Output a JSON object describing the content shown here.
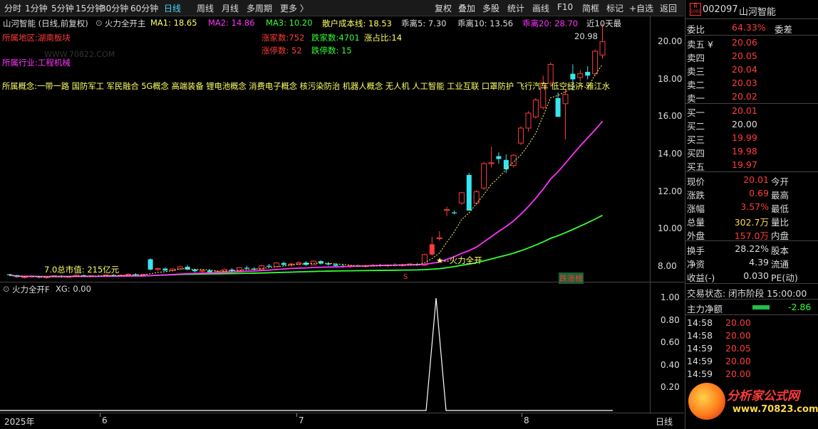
{
  "toolbar": {
    "items": [
      "分时",
      "1分钟",
      "5分钟",
      "15分钟",
      "30分钟",
      "60分钟",
      "日线",
      "周线",
      "月线",
      "多周期",
      "更多 〉"
    ],
    "right_items": [
      "复权",
      "叠加",
      "多股",
      "统计",
      "画线",
      "F10",
      "简框",
      "标记",
      "+自选",
      "返回"
    ]
  },
  "main_info": {
    "stock_title": "山河智能 (日线,前复权)",
    "indicator_name": "火力全开主",
    "ma1": "MA1: 18.65",
    "ma2": "MA2: 14.86",
    "ma3": "MA3: 10.20",
    "retail_cost": "散户成本线: 18.53",
    "dev5": "乖离5: 7.30",
    "dev10": "乖离10: 13.56",
    "dev20": "乖离20: 28.70",
    "recent10": "近10天最",
    "up_count": "涨家数:752",
    "down_count": "跌家数:4701",
    "up_ratio": "涨占比:14",
    "limit_up": "涨停数: 52",
    "limit_down": "跌停数: 15",
    "region": "所属地区:湖南板块",
    "industry": "所属行业:工程机械",
    "concepts": "所属概念:一带一路 国防军工 军民融合 5G概念 高端装备 锂电池概念 消费电子概念 核污染防治 机器人概念 无人机 人工智能 工业互联 口罩防护 飞行汽车 低空经济 雅江水",
    "watermark": "WWW.70822.COM",
    "high_label": "20.98",
    "low_label": "7.0总市值: 215亿元",
    "signal_label": "★--火力全开",
    "s_mark": "S",
    "dragon_tag": "跌涨榜"
  },
  "price_axis": [
    "20.00",
    "18.00",
    "16.00",
    "14.00",
    "12.00",
    "10.00",
    "8.00"
  ],
  "sub_info": {
    "name": "火力全开F",
    "xg": "XG: 0.00"
  },
  "sub_axis": [
    "1.00",
    "0.80",
    "0.60",
    "0.40",
    "0.20"
  ],
  "time_axis": [
    "2025年",
    "6",
    "7",
    "8"
  ],
  "time_axis_right": "日线",
  "right_panel": {
    "code": "002097",
    "name": "山河智能",
    "r_badge": "R",
    "r_sub": "1000",
    "weibi_label": "委比",
    "weibi_value": "64.33%",
    "weicha_label": "委差",
    "asks": [
      {
        "label": "卖五 ¥",
        "price": "20.06"
      },
      {
        "label": "卖四",
        "price": "20.05"
      },
      {
        "label": "卖三",
        "price": "20.04"
      },
      {
        "label": "卖二",
        "price": "20.03"
      },
      {
        "label": "卖一",
        "price": "20.02"
      }
    ],
    "bids": [
      {
        "label": "买一",
        "price": "20.01"
      },
      {
        "label": "买二",
        "price": "20.00"
      },
      {
        "label": "买三",
        "price": "19.99"
      },
      {
        "label": "买四",
        "price": "19.98"
      },
      {
        "label": "买五",
        "price": "19.97"
      }
    ],
    "stats": [
      {
        "l1": "现价",
        "v1": "20.01",
        "l2": "今开",
        "c": "#ff3b3b"
      },
      {
        "l1": "涨跌",
        "v1": "0.69",
        "l2": "最高",
        "c": "#ff3b3b"
      },
      {
        "l1": "涨幅",
        "v1": "3.57%",
        "l2": "最低",
        "c": "#ff3b3b"
      },
      {
        "l1": "总量",
        "v1": "302.7万",
        "l2": "量比",
        "c": "#ffd84a"
      },
      {
        "l1": "外盘",
        "v1": "157.0万",
        "l2": "内盘",
        "c": "#ff3b3b"
      }
    ],
    "stats2": [
      {
        "l1": "换手",
        "v1": "28.22%",
        "l2": "股本"
      },
      {
        "l1": "净资",
        "v1": "4.39",
        "l2": "流通"
      },
      {
        "l1": "收益(-)",
        "v1": "0.030",
        "l2": "PE(动)"
      }
    ],
    "trade_status": "交易状态: 闭市阶段 15:00:00",
    "main_net_label": "主力净额",
    "main_net_value": "-2.86",
    "ticks": [
      {
        "t": "14:58",
        "p": "20.00"
      },
      {
        "t": "14:58",
        "p": "20.00"
      },
      {
        "t": "14:59",
        "p": "20.05"
      },
      {
        "t": "14:59",
        "p": "20.00"
      },
      {
        "t": "14:59",
        "p": "20.00"
      },
      {
        "t": "14:59",
        "p": "20.00"
      },
      {
        "t": "14:59",
        "p": "20.00"
      }
    ],
    "logo_text": "分析家公式网",
    "logo_url": "www.70823.com"
  },
  "colors": {
    "up": "#ff3b3b",
    "down": "#37e6f0",
    "ma1": "#ffff66",
    "ma2": "#ff33ff",
    "ma3": "#33ff33",
    "accent": "#4fd3ff"
  },
  "chart_data": {
    "type": "candlestick",
    "ylim": [
      7.2,
      21.4
    ],
    "candles": [
      [
        7.6,
        7.62,
        7.5,
        7.55
      ],
      [
        7.55,
        7.58,
        7.42,
        7.45
      ],
      [
        7.45,
        7.5,
        7.38,
        7.46
      ],
      [
        7.46,
        7.55,
        7.4,
        7.5
      ],
      [
        7.5,
        7.52,
        7.4,
        7.42
      ],
      [
        7.42,
        7.5,
        7.35,
        7.47
      ],
      [
        7.47,
        7.55,
        7.44,
        7.52
      ],
      [
        7.52,
        7.55,
        7.42,
        7.45
      ],
      [
        7.45,
        7.5,
        7.4,
        7.48
      ],
      [
        7.48,
        7.6,
        7.45,
        7.55
      ],
      [
        7.55,
        7.58,
        7.45,
        7.48
      ],
      [
        7.48,
        7.55,
        7.44,
        7.52
      ],
      [
        7.52,
        7.56,
        7.46,
        7.5
      ],
      [
        7.5,
        7.6,
        7.47,
        7.56
      ],
      [
        7.56,
        7.62,
        7.5,
        7.53
      ],
      [
        7.53,
        7.58,
        7.48,
        7.55
      ],
      [
        7.55,
        7.65,
        7.52,
        7.6
      ],
      [
        7.6,
        7.66,
        7.52,
        7.55
      ],
      [
        7.55,
        7.62,
        7.5,
        7.58
      ],
      [
        8.4,
        8.45,
        7.8,
        7.85
      ],
      [
        7.85,
        7.95,
        7.78,
        7.9
      ],
      [
        7.9,
        7.95,
        7.76,
        7.8
      ],
      [
        7.8,
        7.92,
        7.75,
        7.88
      ],
      [
        7.88,
        8.05,
        7.85,
        8.0
      ],
      [
        8.0,
        8.1,
        7.82,
        7.85
      ],
      [
        7.85,
        7.9,
        7.7,
        7.76
      ],
      [
        7.76,
        7.85,
        7.7,
        7.8
      ],
      [
        7.8,
        7.88,
        7.66,
        7.7
      ],
      [
        7.7,
        7.8,
        7.66,
        7.75
      ],
      [
        7.75,
        7.9,
        7.72,
        7.85
      ],
      [
        7.85,
        7.92,
        7.75,
        7.78
      ],
      [
        7.78,
        7.98,
        7.76,
        7.95
      ],
      [
        7.95,
        8.05,
        7.85,
        7.9
      ],
      [
        7.9,
        7.98,
        7.8,
        7.85
      ],
      [
        7.85,
        8.1,
        7.82,
        8.05
      ],
      [
        8.05,
        8.15,
        7.95,
        8.0
      ],
      [
        8.0,
        8.25,
        7.98,
        8.2
      ],
      [
        8.2,
        8.28,
        8.05,
        8.1
      ],
      [
        8.1,
        8.2,
        8.0,
        8.15
      ],
      [
        8.15,
        8.3,
        8.1,
        8.22
      ],
      [
        8.22,
        8.3,
        8.05,
        8.1
      ],
      [
        8.1,
        8.35,
        8.08,
        8.3
      ],
      [
        8.3,
        8.35,
        8.12,
        8.18
      ],
      [
        8.18,
        8.25,
        8.05,
        8.12
      ],
      [
        8.12,
        8.2,
        8.0,
        8.05
      ],
      [
        8.05,
        8.12,
        7.95,
        8.0
      ],
      [
        8.0,
        8.1,
        7.94,
        8.05
      ],
      [
        8.05,
        8.12,
        7.98,
        8.02
      ],
      [
        8.02,
        8.1,
        7.96,
        8.05
      ],
      [
        8.05,
        8.15,
        8.0,
        8.08
      ],
      [
        8.08,
        8.15,
        8.0,
        8.05
      ],
      [
        8.05,
        8.12,
        7.98,
        8.1
      ],
      [
        8.1,
        8.18,
        8.02,
        8.06
      ],
      [
        8.06,
        8.15,
        8.0,
        8.1
      ],
      [
        8.1,
        8.2,
        8.05,
        8.15
      ],
      [
        8.15,
        8.2,
        8.05,
        8.08
      ],
      [
        8.08,
        8.7,
        8.05,
        8.65
      ],
      [
        8.65,
        9.6,
        8.6,
        9.2
      ],
      [
        9.5,
        9.9,
        9.4,
        9.55
      ],
      [
        11.0,
        11.2,
        10.7,
        11.05
      ],
      [
        10.9,
        11.0,
        10.8,
        10.85
      ],
      [
        11.4,
        12.0,
        11.3,
        11.95
      ],
      [
        12.9,
        13.0,
        11.0,
        11.0
      ],
      [
        11.4,
        12.1,
        11.3,
        12.0
      ],
      [
        12.2,
        13.6,
        12.1,
        13.5
      ],
      [
        13.5,
        14.4,
        13.3,
        13.55
      ],
      [
        13.9,
        14.1,
        13.5,
        13.75
      ],
      [
        13.7,
        14.0,
        13.0,
        13.2
      ],
      [
        13.4,
        14.0,
        13.3,
        13.95
      ],
      [
        14.6,
        15.5,
        14.5,
        15.4
      ],
      [
        15.4,
        16.3,
        15.2,
        16.2
      ],
      [
        16.0,
        17.0,
        15.9,
        16.9
      ],
      [
        16.5,
        18.2,
        16.4,
        17.8
      ],
      [
        17.8,
        18.9,
        17.6,
        18.8
      ],
      [
        17.0,
        17.3,
        16.0,
        16.0
      ],
      [
        16.7,
        17.5,
        14.8,
        17.2
      ],
      [
        18.3,
        18.8,
        17.4,
        18.0
      ],
      [
        18.1,
        18.5,
        17.9,
        18.3
      ],
      [
        18.4,
        18.7,
        18.0,
        18.2
      ],
      [
        18.3,
        19.6,
        18.2,
        19.5
      ],
      [
        19.3,
        20.98,
        19.1,
        20.01
      ]
    ]
  }
}
